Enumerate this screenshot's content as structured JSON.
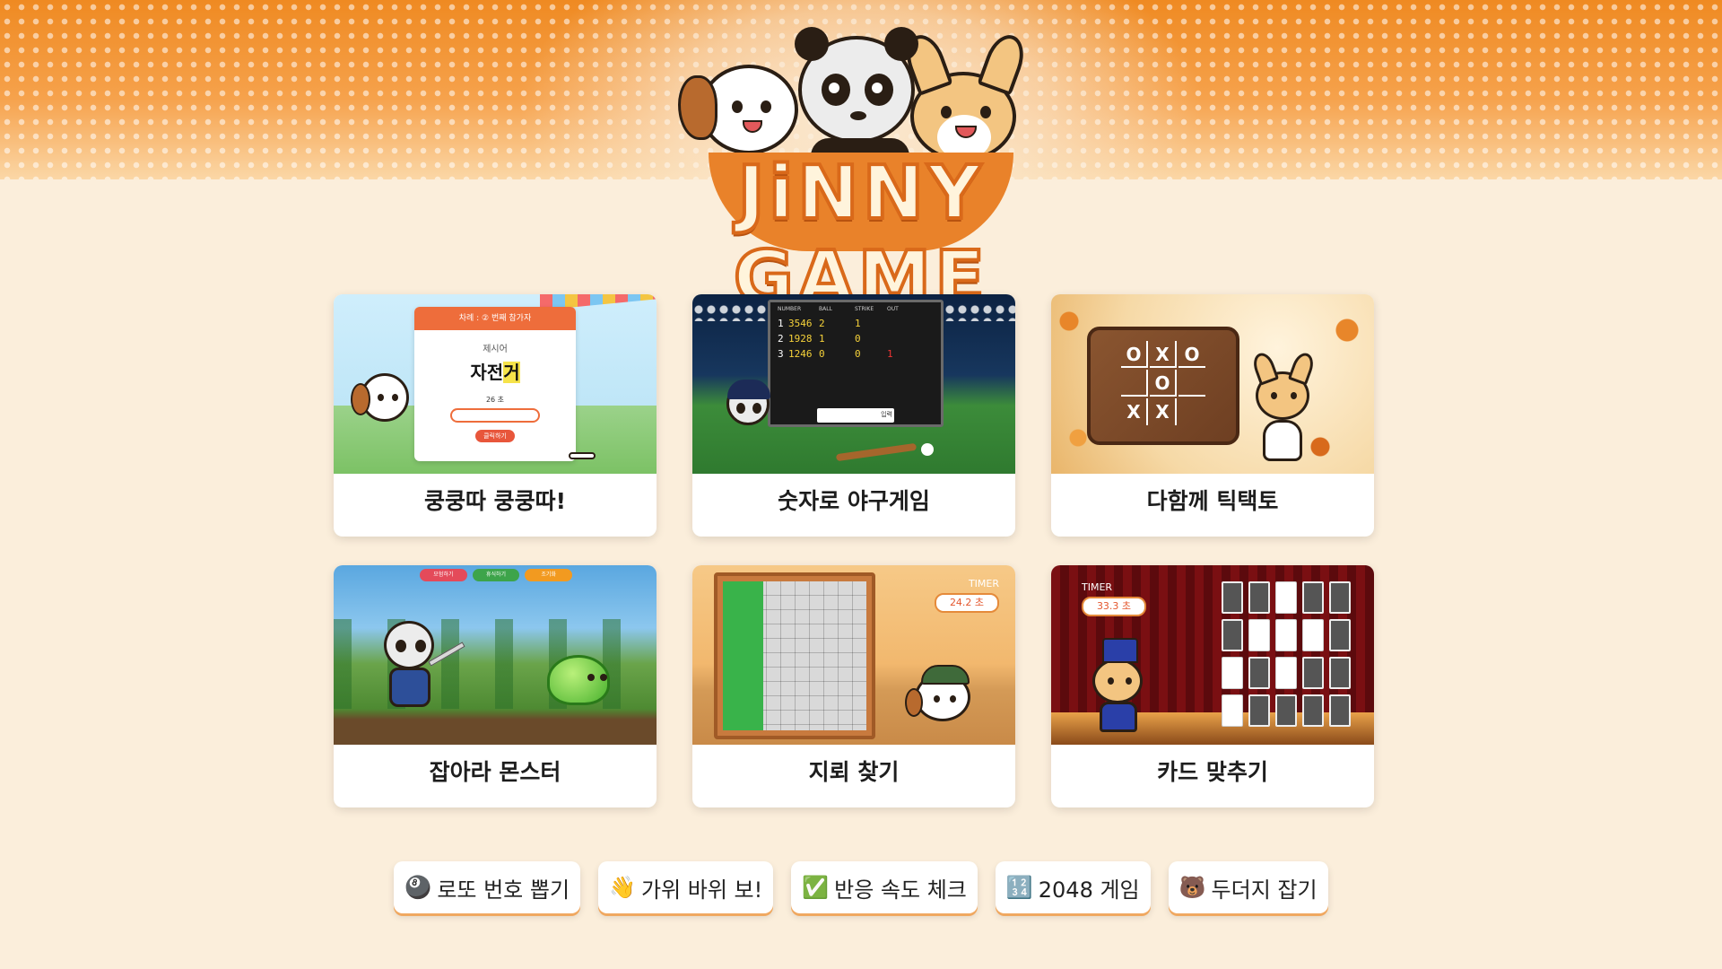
{
  "header": {
    "logo_text": "JiNNY GAME",
    "brand_color": "#f0892a"
  },
  "games": [
    {
      "title": "쿵쿵따 쿵쿵따!",
      "preview": {
        "turn_label": "차례 : ② 번째 참가자",
        "prompt_label": "제시어",
        "word_start": "자전",
        "word_highlight": "거",
        "timer": "26 초",
        "submit": "클릭하기"
      }
    },
    {
      "title": "숫자로 야구게임",
      "preview": {
        "headers": [
          "NUMBER",
          "BALL",
          "STRIKE",
          "OUT"
        ],
        "rows": [
          [
            "1",
            "3546",
            "2",
            "1",
            ""
          ],
          [
            "2",
            "1928",
            "1",
            "0",
            ""
          ],
          [
            "3",
            "1246",
            "0",
            "0",
            "1"
          ]
        ],
        "input_button": "입력"
      }
    },
    {
      "title": "다함께 틱택토",
      "preview": {
        "board": [
          "O",
          "X",
          "O",
          "",
          "O",
          "",
          "X",
          "X",
          ""
        ]
      }
    },
    {
      "title": "잡아라 몬스터",
      "preview": {
        "buttons": [
          "모험하기",
          "휴식하기",
          "조기화"
        ]
      }
    },
    {
      "title": "지뢰 찾기",
      "preview": {
        "timer_label": "TIMER",
        "timer_value": "24.2 초"
      }
    },
    {
      "title": "카드 맞추기",
      "preview": {
        "timer_label": "TIMER",
        "timer_value": "33.3 초"
      }
    }
  ],
  "mini_games": [
    {
      "icon": "🎱",
      "label": "로또 번호 뽑기"
    },
    {
      "icon": "👋",
      "label": "가위 바위 보!"
    },
    {
      "icon": "✅",
      "label": "반응 속도 체크"
    },
    {
      "icon": "🔢",
      "label": "2048 게임"
    },
    {
      "icon": "🐻",
      "label": "두더지 잡기"
    }
  ]
}
